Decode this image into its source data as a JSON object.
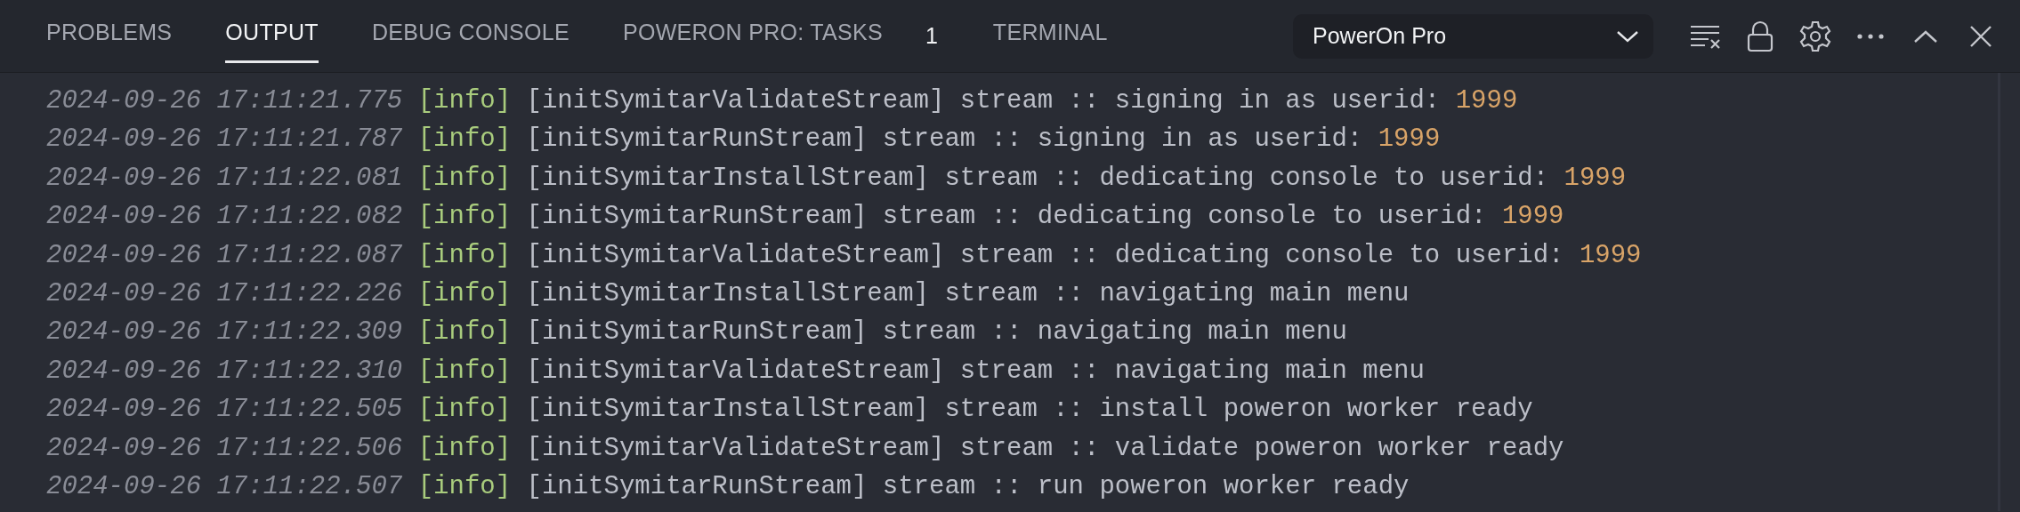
{
  "tabs": [
    {
      "label": "PROBLEMS",
      "selected": false
    },
    {
      "label": "OUTPUT",
      "selected": true
    },
    {
      "label": "DEBUG CONSOLE",
      "selected": false
    },
    {
      "label": "POWERON PRO: TASKS",
      "selected": false,
      "badge": "1"
    },
    {
      "label": "TERMINAL",
      "selected": false
    }
  ],
  "channel_select": {
    "value": "PowerOn Pro"
  },
  "log_lines": [
    {
      "timestamp": "2024-09-26 17:11:21.775",
      "level": "[info]",
      "source": "[initSymitarValidateStream]",
      "message": "stream :: signing in as userid:",
      "value": "1999"
    },
    {
      "timestamp": "2024-09-26 17:11:21.787",
      "level": "[info]",
      "source": "[initSymitarRunStream]",
      "message": "stream :: signing in as userid:",
      "value": "1999"
    },
    {
      "timestamp": "2024-09-26 17:11:22.081",
      "level": "[info]",
      "source": "[initSymitarInstallStream]",
      "message": "stream :: dedicating console to userid:",
      "value": "1999"
    },
    {
      "timestamp": "2024-09-26 17:11:22.082",
      "level": "[info]",
      "source": "[initSymitarRunStream]",
      "message": "stream :: dedicating console to userid:",
      "value": "1999"
    },
    {
      "timestamp": "2024-09-26 17:11:22.087",
      "level": "[info]",
      "source": "[initSymitarValidateStream]",
      "message": "stream :: dedicating console to userid:",
      "value": "1999"
    },
    {
      "timestamp": "2024-09-26 17:11:22.226",
      "level": "[info]",
      "source": "[initSymitarInstallStream]",
      "message": "stream :: navigating main menu"
    },
    {
      "timestamp": "2024-09-26 17:11:22.309",
      "level": "[info]",
      "source": "[initSymitarRunStream]",
      "message": "stream :: navigating main menu"
    },
    {
      "timestamp": "2024-09-26 17:11:22.310",
      "level": "[info]",
      "source": "[initSymitarValidateStream]",
      "message": "stream :: navigating main menu"
    },
    {
      "timestamp": "2024-09-26 17:11:22.505",
      "level": "[info]",
      "source": "[initSymitarInstallStream]",
      "message": "stream :: install poweron worker ready"
    },
    {
      "timestamp": "2024-09-26 17:11:22.506",
      "level": "[info]",
      "source": "[initSymitarValidateStream]",
      "message": "stream :: validate poweron worker ready"
    },
    {
      "timestamp": "2024-09-26 17:11:22.507",
      "level": "[info]",
      "source": "[initSymitarRunStream]",
      "message": "stream :: run poweron worker ready"
    }
  ]
}
